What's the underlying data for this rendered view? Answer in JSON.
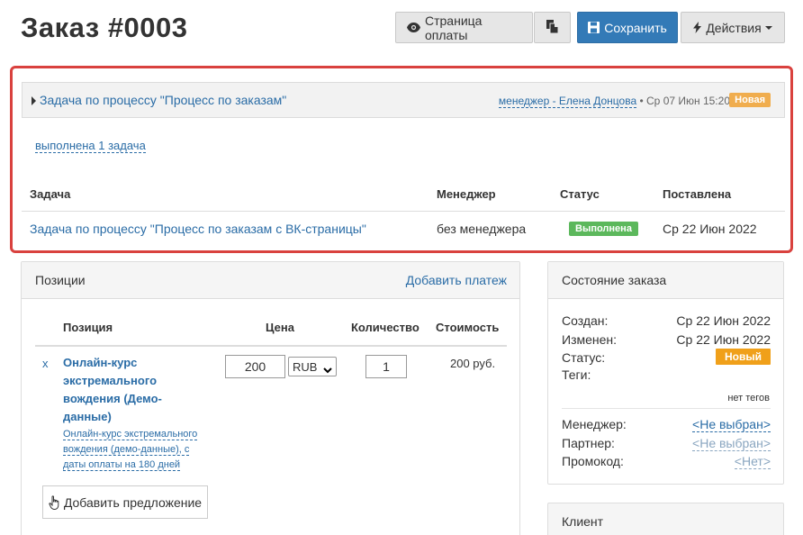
{
  "header": {
    "title": "Заказ #0003",
    "buttons": {
      "payment_page": "Страница оплаты",
      "save": "Сохранить",
      "actions": "Действия"
    }
  },
  "task_panel": {
    "process_link": "Задача по процессу \"Процесс по заказам\"",
    "manager_link": "менеджер - Елена Донцова",
    "date": "• Ср 07 Июн 15:20",
    "badge": "Новая",
    "completed_link": "выполнена 1 задача",
    "table": {
      "headers": [
        "Задача",
        "Менеджер",
        "Статус",
        "Поставлена"
      ],
      "rows": [
        {
          "task": "Задача по процессу \"Процесс по заказам с ВК-страницы\"",
          "manager": "без менеджера",
          "status": "Выполнена",
          "created": "Ср 22 Июн 2022"
        }
      ]
    }
  },
  "positions": {
    "title": "Позиции",
    "add_payment": "Добавить платеж",
    "headers": {
      "position": "Позиция",
      "price": "Цена",
      "quantity": "Количество",
      "cost": "Стоимость"
    },
    "items": [
      {
        "remove": "x",
        "name": "Онлайн-курс экстремального вождения (Демо-данные)",
        "description": "Онлайн-курс экстремального вождения (демо-данные), с даты оплаты на 180 дней",
        "price": "200",
        "currency": "RUB",
        "quantity": "1",
        "cost": "200 руб."
      }
    ],
    "add_offer": "Добавить предложение"
  },
  "order_state": {
    "title": "Состояние заказа",
    "created_label": "Создан:",
    "created_value": "Ср 22 Июн 2022",
    "modified_label": "Изменен:",
    "modified_value": "Ср 22 Июн 2022",
    "status_label": "Статус:",
    "status_value": "Новый",
    "tags_label": "Теги:",
    "tags_value": "нет тегов",
    "manager_label": "Менеджер:",
    "manager_value": "<Не выбран>",
    "partner_label": "Партнер:",
    "partner_value": "<Не выбран>",
    "promo_label": "Промокод:",
    "promo_value": "<Нет>"
  },
  "client": {
    "title": "Клиент"
  },
  "colors": {
    "primary": "#337ab7",
    "link": "#2a6ca6",
    "highlight_border": "#d9413e",
    "badge_new": "#f0ad4e",
    "badge_done": "#5cb85c"
  }
}
